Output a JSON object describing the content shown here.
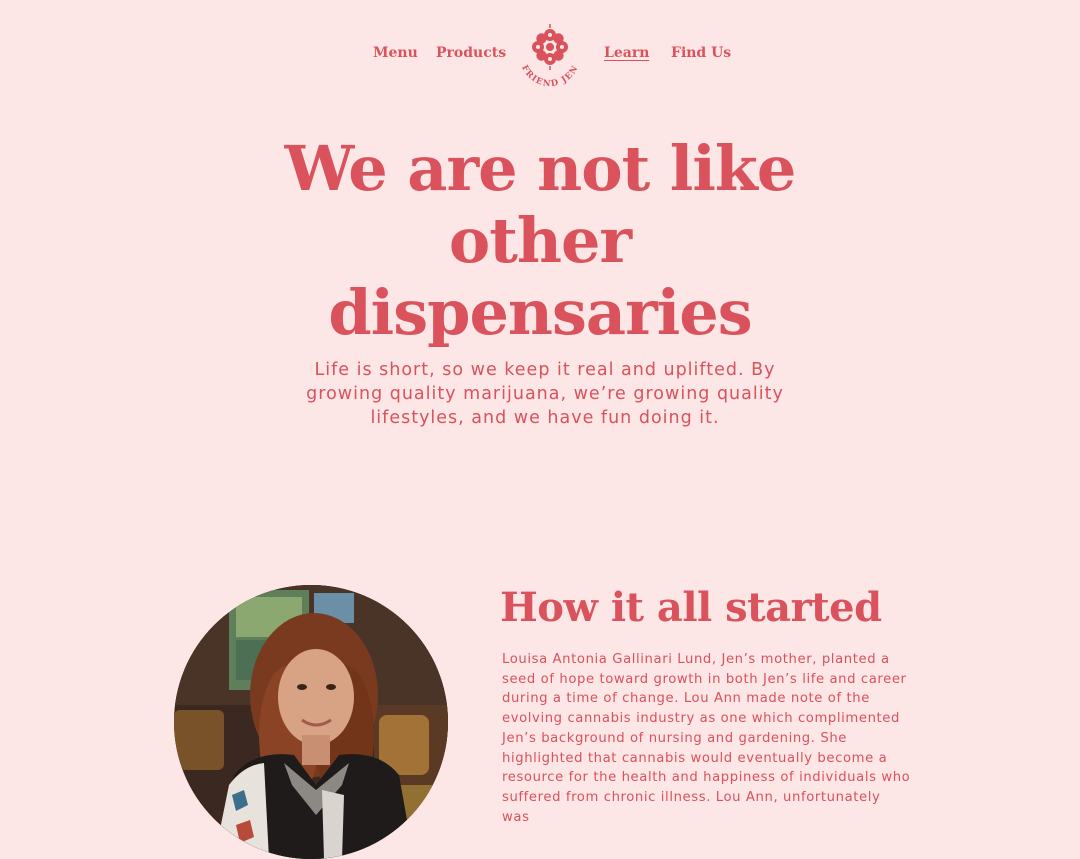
{
  "nav": {
    "menu_label": "Menu",
    "products_label": "Products",
    "learn_label": "Learn",
    "findus_label": "Find Us",
    "logo_text": "FRIEND JEN"
  },
  "hero": {
    "title": "We are not like other dispensaries",
    "subtitle": "Life is short, so we keep it real and uplifted. By growing quality marijuana, we’re growing quality lifestyles, and we have fun doing it."
  },
  "story": {
    "title": "How it all started",
    "body": "Louisa Antonia Gallinari Lund, Jen’s mother, planted a seed of hope toward growth in both Jen’s life and career during a time of change. Lou Ann made note of the evolving cannabis industry as one which complimented Jen’s background of nursing and gardening. She highlighted that cannabis would eventually become a resource for the health and happiness of individuals who suffered from chronic illness. Lou Ann, unfortunately was"
  },
  "colors": {
    "background": "#fce6e6",
    "accent": "#d9525c"
  }
}
